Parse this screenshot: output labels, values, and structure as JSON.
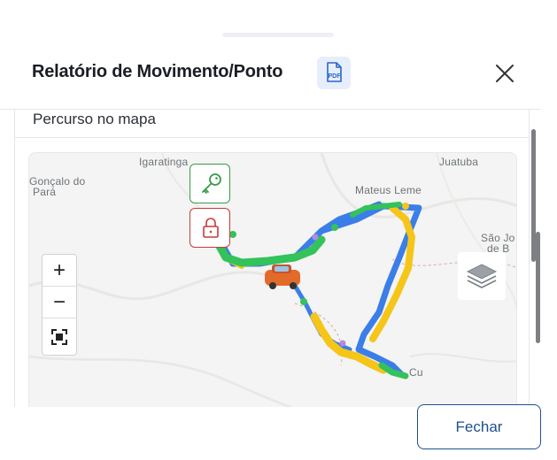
{
  "header": {
    "title": "Relatório de Movimento/Ponto",
    "pdf_icon_text": "PDF"
  },
  "card": {
    "title": "Percurso no mapa"
  },
  "map": {
    "labels": [
      "Igaratinga",
      "Gonçalo do",
      "Pará",
      "Juatuba",
      "Mateus Leme",
      "São Jo",
      "de B",
      "Cu"
    ],
    "zoom_in": "+",
    "zoom_out": "−",
    "route_colors": {
      "primary": "#3b7ee8",
      "stop": "#34c25a",
      "speed": "#f5c518"
    }
  },
  "footer": {
    "close_label": "Fechar"
  },
  "colors": {
    "accent": "#1d4f91",
    "key_event": "#3a9a4a",
    "lock_event": "#c63a3a"
  }
}
